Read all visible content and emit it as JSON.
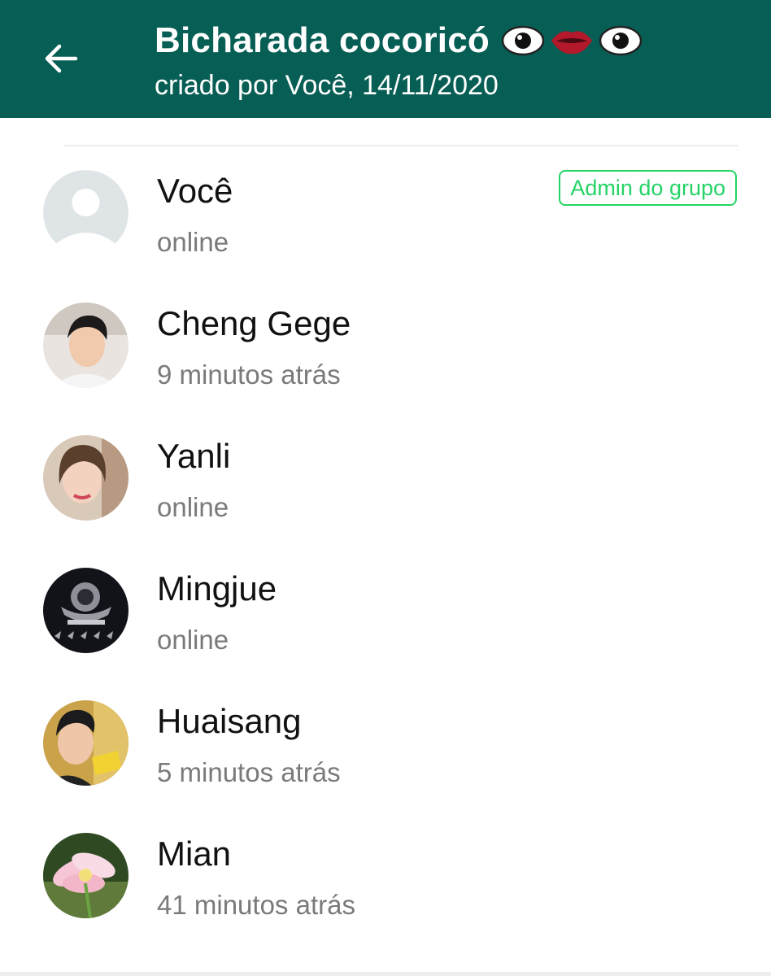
{
  "header": {
    "title": "Bicharada cocoricó",
    "title_emoji_icons": [
      "eye-icon",
      "lips-icon",
      "eye-icon"
    ],
    "subtitle": "criado por Você, 14/11/2020",
    "background_color": "#075e54"
  },
  "members": [
    {
      "name": "Você",
      "status": "online",
      "badge": "Admin do grupo",
      "avatar_icon": "default-avatar-icon"
    },
    {
      "name": "Cheng Gege",
      "status": "9 minutos atrás",
      "avatar_icon": "photo-avatar-man"
    },
    {
      "name": "Yanli",
      "status": "online",
      "avatar_icon": "photo-avatar-woman"
    },
    {
      "name": "Mingjue",
      "status": "online",
      "avatar_icon": "emblem-avatar"
    },
    {
      "name": "Huaisang",
      "status": "5 minutos atrás",
      "avatar_icon": "photo-avatar-man"
    },
    {
      "name": "Mian",
      "status": "41 minutos atrás",
      "avatar_icon": "flower-avatar"
    }
  ],
  "colors": {
    "accent_green": "#25d366",
    "status_gray": "#7a7a7a"
  }
}
